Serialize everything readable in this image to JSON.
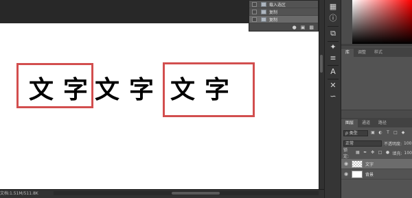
{
  "history": {
    "items": [
      {
        "label": "载入选区",
        "selected": false
      },
      {
        "label": "复制",
        "selected": false
      },
      {
        "label": "复制",
        "selected": true
      }
    ],
    "toolbar_icons": [
      "snapshot-icon",
      "camera-icon",
      "trash-icon"
    ]
  },
  "canvas": {
    "text_1": "文字",
    "text_2": "文字",
    "text_3": "文字",
    "box_color": "#d24e4e"
  },
  "status": {
    "doc_info": "文档:1.51M/511.8K"
  },
  "panels": {
    "library_tabs": [
      "库",
      "调整",
      "样式"
    ],
    "layers_tabs": [
      "图层",
      "通道",
      "路径"
    ],
    "filter_kind": "ρ 类型",
    "blend_mode": "正常",
    "opacity_label": "不透明度:",
    "opacity_value": "100",
    "lock_label": "锁定:",
    "fill_label": "填充:",
    "fill_value": "100",
    "layers": [
      {
        "name": "文字",
        "selected": true,
        "thumb": "transparent"
      },
      {
        "name": "背景",
        "selected": false,
        "thumb": "white"
      }
    ]
  }
}
